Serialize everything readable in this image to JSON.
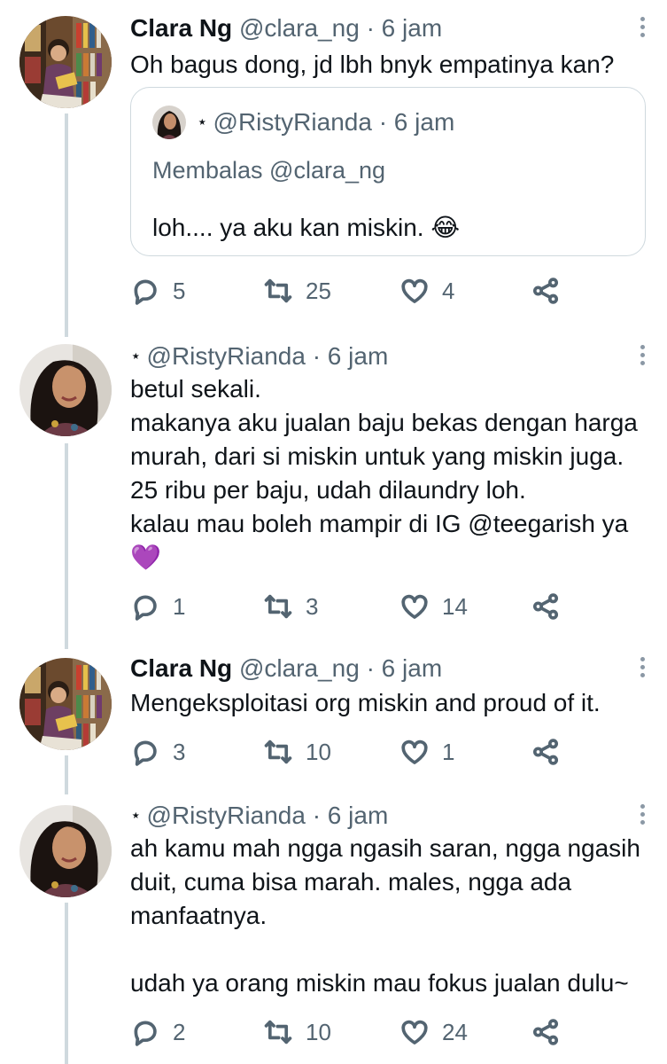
{
  "tweets": [
    {
      "name": "Clara Ng",
      "handle": "@clara_ng",
      "separator": "·",
      "time": "6 jam",
      "text": "Oh bagus dong, jd lbh bnyk empatinya kan?",
      "quote": {
        "badge": "⋆",
        "handle": "@RistyRianda",
        "separator": "·",
        "time": "6 jam",
        "reply_to": "Membalas @clara_ng",
        "text": "loh.... ya aku kan miskin. 😂"
      },
      "replies": "5",
      "retweets": "25",
      "likes": "4"
    },
    {
      "name": "",
      "badge": "⋆",
      "handle": "@RistyRianda",
      "separator": "·",
      "time": "6 jam",
      "text": "betul sekali.\nmakanya aku jualan baju bekas dengan harga murah, dari si miskin untuk yang miskin juga.\n25 ribu per baju, udah dilaundry loh.\nkalau mau boleh mampir di IG @teegarish ya\n💜",
      "replies": "1",
      "retweets": "3",
      "likes": "14"
    },
    {
      "name": "Clara Ng",
      "handle": "@clara_ng",
      "separator": "·",
      "time": "6 jam",
      "text": "Mengeksploitasi org miskin and proud of it.",
      "replies": "3",
      "retweets": "10",
      "likes": "1"
    },
    {
      "name": "",
      "badge": "⋆",
      "handle": "@RistyRianda",
      "separator": "·",
      "time": "6 jam",
      "text": "ah kamu mah ngga ngasih saran, ngga ngasih duit, cuma bisa marah. males, ngga ada manfaatnya.\n\nudah ya orang miskin mau fokus jualan dulu~",
      "replies": "2",
      "retweets": "10",
      "likes": "24"
    }
  ],
  "icons": {
    "reply": "reply-icon",
    "retweet": "retweet-icon",
    "like": "heart-icon",
    "share": "share-icon",
    "more": "more-vertical-icon"
  },
  "colors": {
    "text": "#0f1419",
    "secondary": "#536471",
    "thread_line": "#cfd9de",
    "border": "#cfd9de"
  }
}
